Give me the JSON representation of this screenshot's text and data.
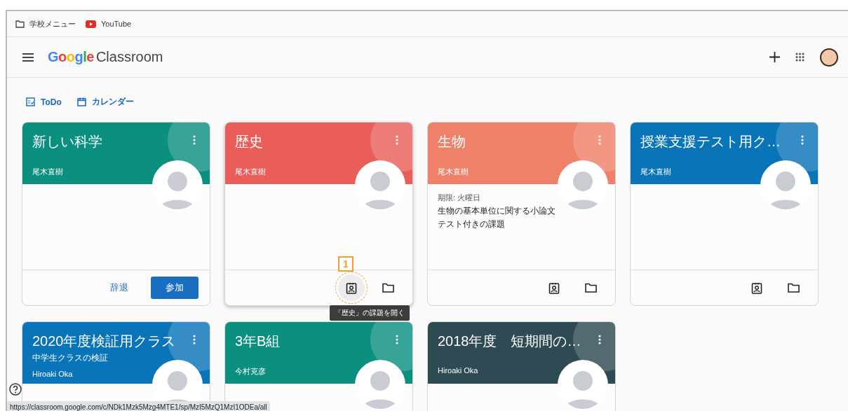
{
  "bookmarks": [
    {
      "kind": "folder",
      "label": "学校メニュー"
    },
    {
      "kind": "youtube",
      "label": "YouTube"
    }
  ],
  "header": {
    "logo_brand": "Google",
    "logo_product": "Classroom"
  },
  "nav": [
    {
      "kind": "todo",
      "label": "ToDo"
    },
    {
      "kind": "calendar",
      "label": "カレンダー"
    }
  ],
  "classes": [
    {
      "title": "新しい科学",
      "teacher": "尾木直樹",
      "color": "#0b9080",
      "kind": "invite",
      "actions": [
        "辞退",
        "参加"
      ]
    },
    {
      "title": "歴史",
      "teacher": "尾木直樹",
      "color": "#ea5e5a",
      "kind": "icons",
      "assignments_highlighted": true,
      "tooltip": "「歴史」の課題を開く",
      "callout": "1"
    },
    {
      "title": "生物",
      "teacher": "尾木直樹",
      "color": "#ef8069",
      "kind": "icons",
      "assignments_highlighted": false,
      "due": "期限: 火曜日",
      "assignment": "生物の基本単位に関する小論文テスト付きの課題"
    },
    {
      "title": "授業支援テスト用ク…",
      "teacher": "尾木直樹",
      "color": "#0a74b9",
      "kind": "icons",
      "assignments_highlighted": false
    },
    {
      "title": "2020年度検証用クラス",
      "subtitle": "中学生クラスの検証",
      "teacher": "Hiroaki Oka",
      "color": "#0a74b9",
      "kind": "plain"
    },
    {
      "title": "3年B組",
      "teacher": "今村克彦",
      "color": "#0b9080",
      "kind": "plain"
    },
    {
      "title": "2018年度　短期間の…",
      "teacher": "Hiroaki Oka",
      "color": "#2e4a52",
      "kind": "plain"
    }
  ],
  "status_url": "https://classroom.google.com/c/NDk1Mzk5Mzg4MTE1/sp/MzI5MzQ1MzI1ODEa/all"
}
